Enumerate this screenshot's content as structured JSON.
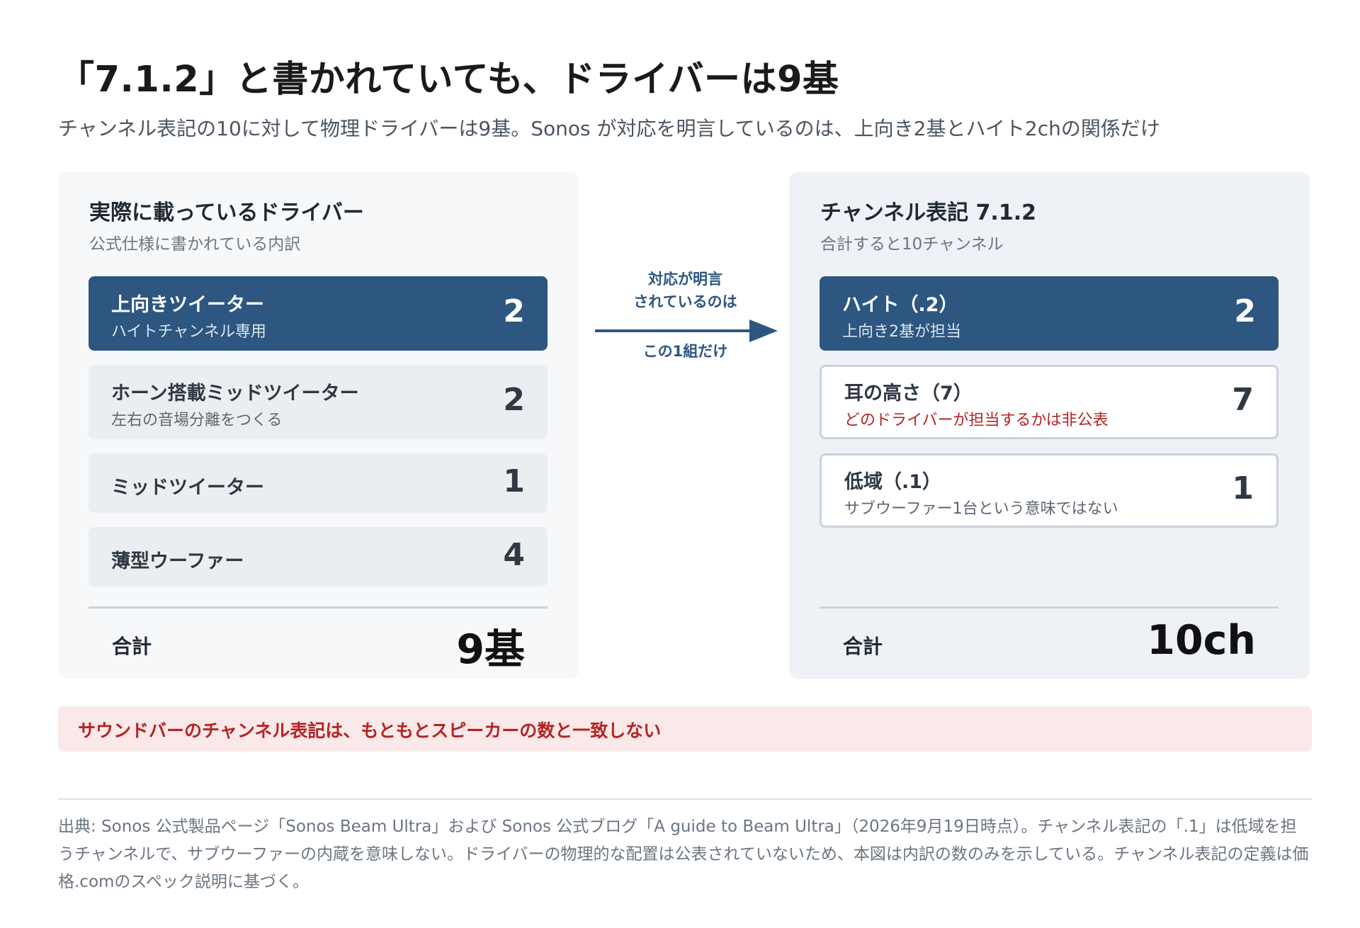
{
  "title": "「7.1.2」と書かれていても、ドライバーは9基",
  "subtitle": "チャンネル表記の10に対して物理ドライバーは9基。Sonos が対応を明言しているのは、上向き2基とハイト2chの関係だけ",
  "left_panel": {
    "title": "実際に載っているドライバー",
    "subtitle": "公式仕様に書かれている内訳",
    "rows": [
      {
        "label": "上向きツイーター",
        "note": "ハイトチャンネル専用",
        "count": "2"
      },
      {
        "label": "ホーン搭載ミッドツイーター",
        "note": "左右の音場分離をつくる",
        "count": "2"
      },
      {
        "label": "ミッドツイーター",
        "count": "1"
      },
      {
        "label": "薄型ウーファー",
        "count": "4"
      }
    ],
    "total_label": "合計",
    "total_value": "9基"
  },
  "connector": {
    "top_line1": "対応が明言",
    "top_line2": "されているのは",
    "bottom": "この1組だけ"
  },
  "right_panel": {
    "title": "チャンネル表記 7.1.2",
    "subtitle": "合計すると10チャンネル",
    "rows": [
      {
        "label": "ハイト（.2）",
        "note": "上向き2基が担当",
        "count": "2"
      },
      {
        "label": "耳の高さ（7）",
        "note": "どのドライバーが担当するかは非公表",
        "count": "7"
      },
      {
        "label": "低域（.1）",
        "note": "サブウーファー1台という意味ではない",
        "count": "1"
      }
    ],
    "total_label": "合計",
    "total_value": "10ch"
  },
  "callout": "サウンドバーのチャンネル表記は、もともとスピーカーの数と一致しない",
  "footnote": "出典: Sonos 公式製品ページ「Sonos Beam Ultra」および Sonos 公式ブログ「A guide to Beam Ultra」（2026年9月19日時点）。チャンネル表記の「.1」は低域を担うチャンネルで、サブウーファーの内蔵を意味しない。ドライバーの物理的な配置は公表されていないため、本図は内訳の数のみを示している。チャンネル表記の定義は価格.comのスペック説明に基づく。",
  "colors": {
    "primary": "#2d5680",
    "warning": "#b42424",
    "callout_bg": "#fbe9e9"
  }
}
